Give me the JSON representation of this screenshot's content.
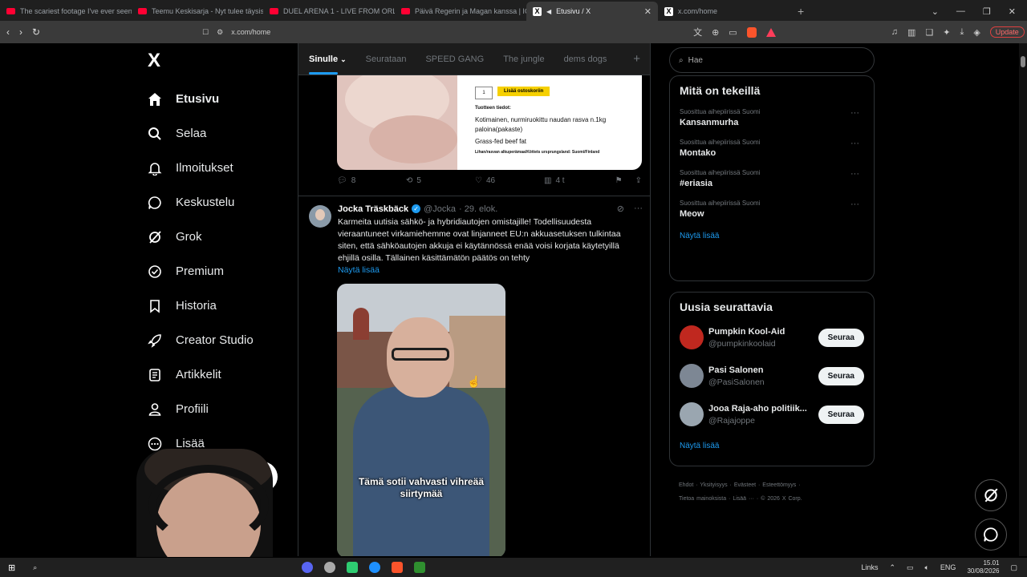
{
  "browser": {
    "tabs": [
      {
        "label": "The scariest footage I've ever seen...",
        "icon": "youtube-icon"
      },
      {
        "label": "Teemu Keskisarja - Nyt tulee täysisid...",
        "icon": "youtube-icon"
      },
      {
        "label": "DUEL ARENA 1 - LIVE FROM ORLAND...",
        "icon": "youtube-icon"
      },
      {
        "label": "Päivä Regerin ja Magan kanssa | ICE...",
        "icon": "youtube-icon"
      },
      {
        "label": "Etusivu / X",
        "icon": "x-icon",
        "active": true
      },
      {
        "label": "x.com/home",
        "icon": "x-icon"
      }
    ],
    "url": "x.com/home",
    "update_label": "Update"
  },
  "sidebar": {
    "logo": "X",
    "items": [
      {
        "label": "Etusivu",
        "icon": "home-icon",
        "bold": true
      },
      {
        "label": "Selaa",
        "icon": "search-icon"
      },
      {
        "label": "Ilmoitukset",
        "icon": "bell-icon"
      },
      {
        "label": "Keskustelu",
        "icon": "chat-icon"
      },
      {
        "label": "Grok",
        "icon": "grok-icon"
      },
      {
        "label": "Premium",
        "icon": "premium-icon"
      },
      {
        "label": "Historia",
        "icon": "bookmark-icon"
      },
      {
        "label": "Creator Studio",
        "icon": "rocket-icon"
      },
      {
        "label": "Artikkelit",
        "icon": "article-icon"
      },
      {
        "label": "Profiili",
        "icon": "person-icon"
      },
      {
        "label": "Lisää",
        "icon": "more-circle-icon"
      }
    ],
    "more": "···"
  },
  "feed": {
    "tabs": [
      "Sinulle",
      "Seurataan",
      "SPEED GANG",
      "The jungle",
      "dems dogs"
    ],
    "product": {
      "qty": "1",
      "add_to_cart": "Lisää ostoskoriin",
      "info_title": "Tuotteen tiedot:",
      "desc": "Kotimainen, nurmiruokittu naudan rasva n.1kg paloina(pakaste)",
      "english": "Grass-fed beef fat",
      "origin": "Lihan/rasvan alkuperämaa/Köttets ursprungsland: Suomi/Finland"
    },
    "post_actions": {
      "replies": "8",
      "reposts": "5",
      "likes": "46",
      "views": "4 t"
    },
    "tweet": {
      "name": "Jocka Träskbäck",
      "handle": "@Jocka",
      "date": "· 29. elok.",
      "text": "Karmeita uutisia sähkö- ja hybridiautojen omistajille! Todellisuudesta vieraantuneet virkamiehemme ovat linjanneet EU:n akkuasetuksen tulkintaa siten, että sähköautojen akkuja ei käytännössä enää voisi korjata käytetyillä ehjillä osilla. Tällainen käsittämätön päätös on tehty",
      "show_more": "Näytä lisää",
      "caption": "Tämä sotii vahvasti vihreää siirtymää"
    }
  },
  "right": {
    "search_placeholder": "Hae",
    "trends_title": "Mitä on tekeillä",
    "trends": [
      {
        "context": "Suosittua aihepiirissä Suomi",
        "title": "Kansanmurha"
      },
      {
        "context": "Suosittua aihepiirissä Suomi",
        "title": "Montako"
      },
      {
        "context": "Suosittua aihepiirissä Suomi",
        "title": "#eriasia"
      },
      {
        "context": "Suosittua aihepiirissä Suomi",
        "title": "Meow"
      }
    ],
    "trends_more": "Näytä lisää",
    "follow_title": "Uusia seurattavia",
    "follow": [
      {
        "name": "Pumpkin Kool-Aid",
        "handle": "@pumpkinkoolaid",
        "button": "Seuraa",
        "color": "#c0281f"
      },
      {
        "name": "Pasi Salonen",
        "handle": "@PasiSalonen",
        "button": "Seuraa",
        "color": "#7d8794"
      },
      {
        "name": "Jooa Raja-aho politiik...",
        "handle": "@Rajajoppe",
        "button": "Seuraa",
        "color": "#9aa6b0"
      }
    ],
    "follow_more": "Näytä lisää",
    "footer_line1": "Ehdot · Yksityisyys · Evästeet · Esteettömyys ·",
    "footer_line2": "Tietoa mainoksista · Lisää ··· · © 2026 X Corp."
  },
  "taskbar": {
    "links": "Links",
    "lang": "ENG",
    "time": "15.01",
    "date": "30/08/2026"
  }
}
